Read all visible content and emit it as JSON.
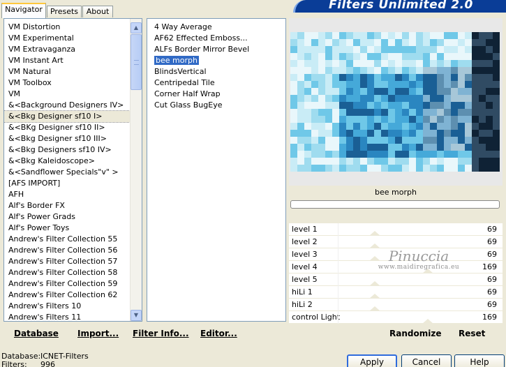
{
  "tabs": [
    {
      "label": "Navigator",
      "active": true
    },
    {
      "label": "Presets",
      "active": false
    },
    {
      "label": "About",
      "active": false
    }
  ],
  "banner_title": "Filters Unlimited 2.0",
  "categories": {
    "items": [
      "VM Distortion",
      "VM Experimental",
      "VM Extravaganza",
      "VM Instant Art",
      "VM Natural",
      "VM Toolbox",
      "VM",
      "&<Background Designers IV>",
      "&<Bkg Designer sf10 I>",
      "&<BKg Designer sf10 II>",
      "&<Bkg Designer sf10 III>",
      "&<Bkg Designers sf10 IV>",
      "&<Bkg Kaleidoscope>",
      "&<Sandflower Specials\"v\" >",
      "[AFS IMPORT]",
      "AFH",
      "Alf's Border FX",
      "Alf's Power Grads",
      "Alf's Power Toys",
      "Andrew's Filter Collection 55",
      "Andrew's Filter Collection 56",
      "Andrew's Filter Collection 57",
      "Andrew's Filter Collection 58",
      "Andrew's Filter Collection 59",
      "Andrew's Filter Collection 62",
      "Andrew's Filters 10",
      "Andrew's Filters 11"
    ],
    "selected_index": 8
  },
  "filters": {
    "items": [
      "4 Way Average",
      "AF62 Effected Emboss...",
      "ALFs Border Mirror Bevel",
      "bee morph",
      "BlindsVertical",
      "Centripedal Tile",
      "Corner Half Wrap",
      "Cut Glass  BugEye"
    ],
    "selected_index": 3
  },
  "preview_label": "bee morph",
  "sliders": [
    {
      "label": "level 1",
      "value": "69",
      "fraction": 0.27
    },
    {
      "label": "level 2",
      "value": "69",
      "fraction": 0.27
    },
    {
      "label": "level 3",
      "value": "69",
      "fraction": 0.27
    },
    {
      "label": "level 4",
      "value": "169",
      "fraction": 0.66
    },
    {
      "label": "level 5",
      "value": "69",
      "fraction": 0.27
    },
    {
      "label": "hiLi 1",
      "value": "69",
      "fraction": 0.27
    },
    {
      "label": "hiLi 2",
      "value": "69",
      "fraction": 0.27
    },
    {
      "label": "control Light",
      "value": "169",
      "fraction": 0.66
    }
  ],
  "links": {
    "database": "Database",
    "import": "Import...",
    "filter_info": "Filter Info...",
    "editor": "Editor...",
    "randomize": "Randomize",
    "reset": "Reset"
  },
  "status": {
    "database_key": "Database:",
    "database_value": "ICNET-Filters",
    "filters_key": "Filters:",
    "filters_value": "996"
  },
  "buttons": {
    "apply": "Apply",
    "cancel": "Cancel",
    "help": "Help"
  },
  "watermark": {
    "name": "Pinuccia",
    "site": "www.maidiregrafica.eu"
  },
  "colors": {
    "selection": "#316ac5",
    "banner": "#0a3d97",
    "face": "#ece9d8"
  }
}
